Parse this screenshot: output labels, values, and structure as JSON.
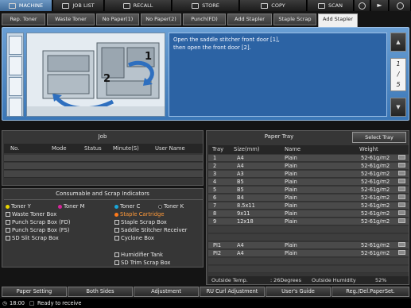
{
  "topbar": {
    "tabs": [
      "MACHINE",
      "JOB LIST",
      "RECALL",
      "STORE",
      "COPY",
      "SCAN"
    ]
  },
  "alerts": {
    "tabs": [
      "Rep. Toner",
      "Waste Toner",
      "No Paper(1)",
      "No Paper(2)",
      "Punch(FD)",
      "Add Stapler",
      "Staple Scrap",
      "Add Stapler"
    ]
  },
  "message": {
    "lines": [
      "Open the saddle stitcher front door [1],",
      "then open the front door [2]."
    ],
    "callouts": [
      "1",
      "2"
    ],
    "page": {
      "current": "1",
      "total": "5"
    }
  },
  "job": {
    "title": "Job",
    "columns": [
      "No.",
      "Mode",
      "Status",
      "Minute(S)",
      "User Name"
    ]
  },
  "consumables": {
    "title": "Consumable and Scrap Indicators",
    "items": [
      {
        "label": "Toner Y",
        "color": "#e8d400"
      },
      {
        "label": "Toner M",
        "color": "#d6259a"
      },
      {
        "label": "Toner C",
        "color": "#19a6d9"
      },
      {
        "label": "Toner K",
        "color": "#111111"
      },
      {
        "label": "Waste Toner Box"
      },
      {
        "label": "Staple Cartridge",
        "color": "#ff7a1a"
      },
      {
        "label": "Punch Scrap Box (FD)"
      },
      {
        "label": "Staple Scrap Box"
      },
      {
        "label": "Punch Scrap Box (FS)"
      },
      {
        "label": "Saddle Stitcher Receiver"
      },
      {
        "label": "SD Slit Scrap Box"
      },
      {
        "label": "Cyclone Box"
      },
      {
        "label": "Humidifier Tank"
      },
      {
        "label": "SD Trim Scrap Box"
      }
    ]
  },
  "paper_tray": {
    "title": "Paper Tray",
    "select_button": "Select Tray",
    "columns": [
      "Tray",
      "Size(mm)",
      "Name",
      "Weight"
    ],
    "rows": [
      {
        "tray": "1",
        "size": "A4",
        "name": "Plain",
        "weight": "52-61g/m2"
      },
      {
        "tray": "2",
        "size": "A4",
        "name": "Plain",
        "weight": "52-61g/m2"
      },
      {
        "tray": "3",
        "size": "A3",
        "name": "Plain",
        "weight": "52-61g/m2"
      },
      {
        "tray": "4",
        "size": "B5",
        "name": "Plain",
        "weight": "52-61g/m2"
      },
      {
        "tray": "5",
        "size": "B5",
        "name": "Plain",
        "weight": "52-61g/m2"
      },
      {
        "tray": "6",
        "size": "B4",
        "name": "Plain",
        "weight": "52-61g/m2"
      },
      {
        "tray": "7",
        "size": "8.5x11",
        "name": "Plain",
        "weight": "52-61g/m2"
      },
      {
        "tray": "8",
        "size": "9x11",
        "name": "Plain",
        "weight": "52-61g/m2"
      },
      {
        "tray": "9",
        "size": "12x18",
        "name": "Plain",
        "weight": "52-61g/m2"
      },
      {
        "tray": "PI1",
        "size": "A4",
        "name": "Plain",
        "weight": "52-61g/m2"
      },
      {
        "tray": "PI2",
        "size": "A4",
        "name": "Plain",
        "weight": "52-61g/m2"
      }
    ],
    "outside_temp_label": "Outside Temp.",
    "outside_temp": ": 26Degrees",
    "outside_humidity_label": "Outside Humidity",
    "outside_humidity": "52%"
  },
  "bottom_buttons": [
    "Paper Setting",
    "Both Sides",
    "Adjustment",
    "RU Curl Adjustment",
    "User's Guide",
    "Reg./Del.PaperSet."
  ],
  "status": {
    "time": "18:00",
    "text": "Ready to receive"
  }
}
